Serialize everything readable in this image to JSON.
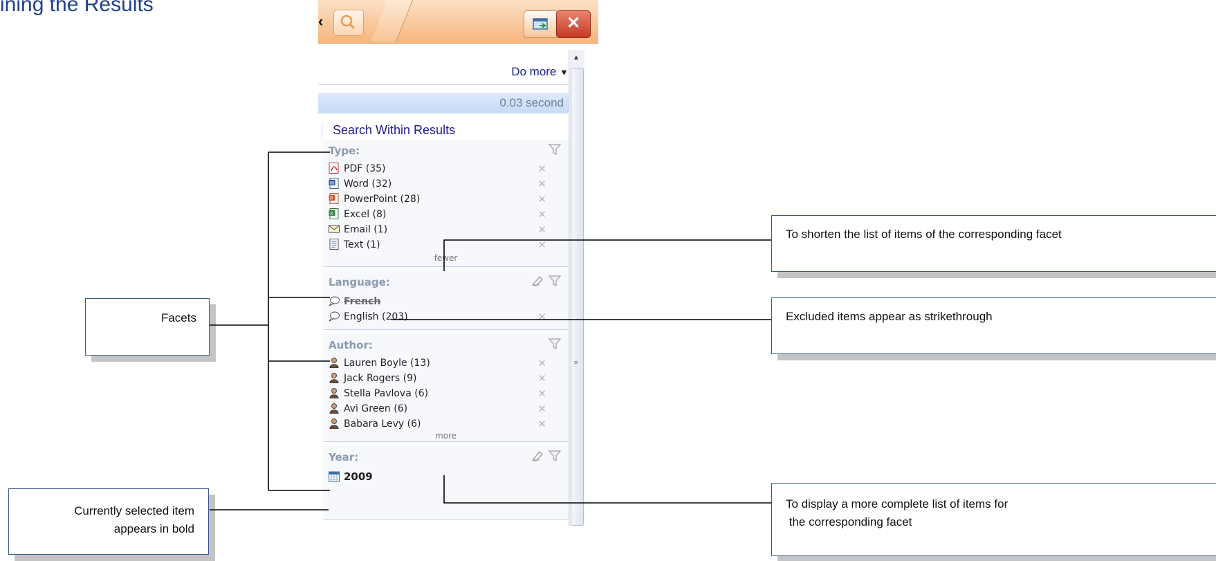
{
  "slide_title": "ining the Results",
  "window": {
    "chevron": "‹",
    "search_icon": "magnifier-icon",
    "fullscreen_icon": "window-export-icon",
    "close_label": "✕"
  },
  "toolbar": {
    "do_more_label": "Do more",
    "do_more_arrow": "▼",
    "time_text": "0.03 second",
    "search_within_label": "Search Within Results"
  },
  "facets": {
    "type": {
      "title": "Type:",
      "items": [
        {
          "label": "PDF (35)",
          "icon": "pdf-icon"
        },
        {
          "label": "Word (32)",
          "icon": "word-icon"
        },
        {
          "label": "PowerPoint (28)",
          "icon": "powerpoint-icon"
        },
        {
          "label": "Excel (8)",
          "icon": "excel-icon"
        },
        {
          "label": "Email (1)",
          "icon": "email-icon"
        },
        {
          "label": "Text (1)",
          "icon": "text-file-icon"
        }
      ],
      "toggle_label": "fewer"
    },
    "language": {
      "title": "Language:",
      "items": [
        {
          "label": "French",
          "icon": "speech-bubble-icon",
          "excluded": true
        },
        {
          "label": "English (203)",
          "icon": "speech-bubble-icon"
        }
      ]
    },
    "author": {
      "title": "Author:",
      "items": [
        {
          "label": "Lauren Boyle (13)",
          "icon": "person-icon"
        },
        {
          "label": "Jack Rogers (9)",
          "icon": "person-icon"
        },
        {
          "label": "Stella Pavlova (6)",
          "icon": "person-icon"
        },
        {
          "label": "Avi Green (6)",
          "icon": "person-icon"
        },
        {
          "label": "Babara Levy (6)",
          "icon": "person-icon"
        }
      ],
      "toggle_label": "more"
    },
    "year": {
      "title": "Year:",
      "items": [
        {
          "label": "2009",
          "icon": "calendar-icon",
          "selected": true
        }
      ]
    }
  },
  "remove_label": "✕",
  "callouts": {
    "facets": "Facets",
    "selected_line1": "Currently selected item",
    "selected_line2": "appears in bold",
    "shorten": "To shorten the list of items of the corresponding facet",
    "excluded": "Excluded items appear as strikethrough",
    "more_line1": "To display a more complete list of items for",
    "more_line2": " the corresponding facet"
  },
  "colors": {
    "title": "#1f3f8f",
    "header_orange": "#f6b47c",
    "close_red": "#c43a24",
    "link_blue": "#1d1d8a",
    "facet_title_gray": "#8b9ab0"
  }
}
